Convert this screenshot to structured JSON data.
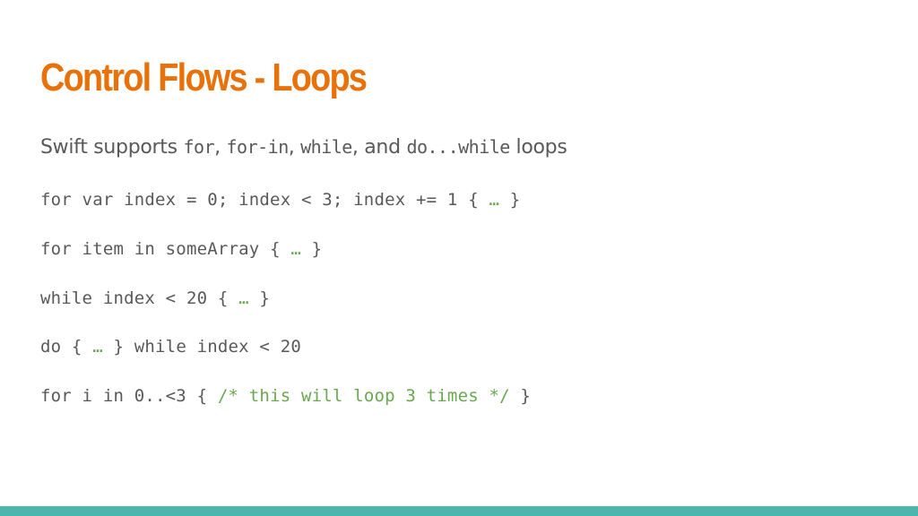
{
  "slide": {
    "title": "Control Flows - Loops",
    "subtitle": {
      "prefix": "Swift supports ",
      "kw1": "for",
      "sep1": ", ",
      "kw2": "for-in",
      "sep2": ", ",
      "kw3": "while",
      "sep3": ", and ",
      "kw4": "do...while",
      "suffix": " loops"
    },
    "code_lines": [
      {
        "code": "for var index = 0; index < 3; index += 1 { ",
        "comment": "…",
        "tail": " }"
      },
      {
        "code": "for item in someArray { ",
        "comment": "…",
        "tail": " }"
      },
      {
        "code": "while index < 20 { ",
        "comment": "…",
        "tail": " }"
      },
      {
        "code": "do { ",
        "comment": "…",
        "tail": " } while index < 20"
      },
      {
        "code": "for i in 0..<3 { ",
        "comment": "/* this will loop 3 times */",
        "tail": " }"
      }
    ]
  },
  "colors": {
    "title": "#e8710a",
    "text": "#595959",
    "comment": "#6aa84f",
    "accent_bar": "#4db6ac"
  }
}
